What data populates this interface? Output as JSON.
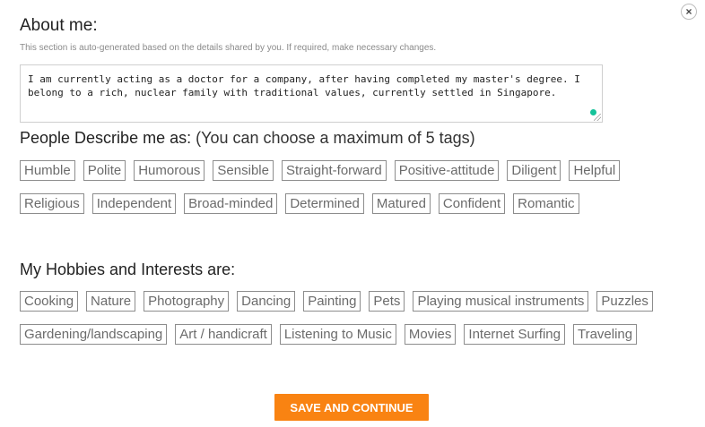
{
  "close_icon": "×",
  "about": {
    "title": "About me:",
    "note": "This section is auto-generated based on the details shared by you. If required, make necessary changes.",
    "text": "I am currently acting as a doctor for a company, after having completed my master's degree. I belong to a rich, nuclear family with traditional values, currently settled in Singapore."
  },
  "describe": {
    "title": "People Describe me as:",
    "subtitle": "(You can choose a maximum of 5 tags)",
    "tags": [
      "Humble",
      "Polite",
      "Humorous",
      "Sensible",
      "Straight-forward",
      "Positive-attitude",
      "Diligent",
      "Helpful",
      "Religious",
      "Independent",
      "Broad-minded",
      "Determined",
      "Matured",
      "Confident",
      "Romantic"
    ]
  },
  "hobbies": {
    "title": "My Hobbies and Interests are:",
    "tags": [
      "Cooking",
      "Nature",
      "Photography",
      "Dancing",
      "Painting",
      "Pets",
      "Playing musical instruments",
      "Puzzles",
      "Gardening/landscaping",
      "Art / handicraft",
      "Listening to Music",
      "Movies",
      "Internet Surfing",
      "Traveling"
    ]
  },
  "save_label": "SAVE AND CONTINUE",
  "colors": {
    "accent": "#f98312",
    "grammar_dot": "#15c39a"
  }
}
